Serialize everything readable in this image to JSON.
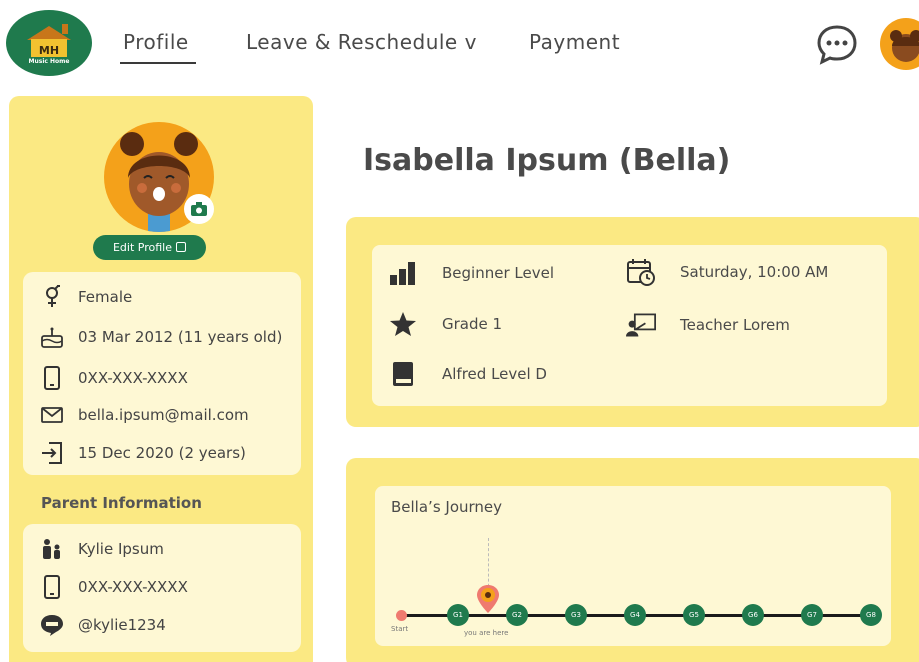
{
  "logo": {
    "initials": "MH",
    "name": "Music Home"
  },
  "nav": {
    "profile": "Profile",
    "leave": "Leave & Reschedule v",
    "payment": "Payment"
  },
  "header": {
    "chat_icon": "chat-bubble-icon",
    "avatar": "user-avatar"
  },
  "profile": {
    "edit_label": "Edit Profile",
    "gender": "Female",
    "birthday": "03 Mar 2012 (11 years old)",
    "phone": "0XX-XXX-XXXX",
    "email": "bella.ipsum@mail.com",
    "joined": "15 Dec 2020 (2 years)"
  },
  "parent": {
    "heading": "Parent Information",
    "name": "Kylie Ipsum",
    "phone": "0XX-XXX-XXXX",
    "line_id": "@kylie1234"
  },
  "student": {
    "name": "Isabella Ipsum (Bella)",
    "level": "Beginner Level",
    "grade": "Grade 1",
    "book": "Alfred Level D",
    "schedule": "Saturday, 10:00 AM",
    "teacher": "Teacher Lorem"
  },
  "journey": {
    "title": "Bella’s Journey",
    "start_label": "Start",
    "current_label": "you are here",
    "current_index": 0,
    "nodes": [
      "G1",
      "G2",
      "G3",
      "G4",
      "G5",
      "G6",
      "G7",
      "G8"
    ]
  },
  "colors": {
    "panel": "#fbe983",
    "card": "#fef8d4",
    "accent": "#1f7a4d",
    "avatar": "#f4a11a",
    "marker": "#ef7a6f"
  }
}
